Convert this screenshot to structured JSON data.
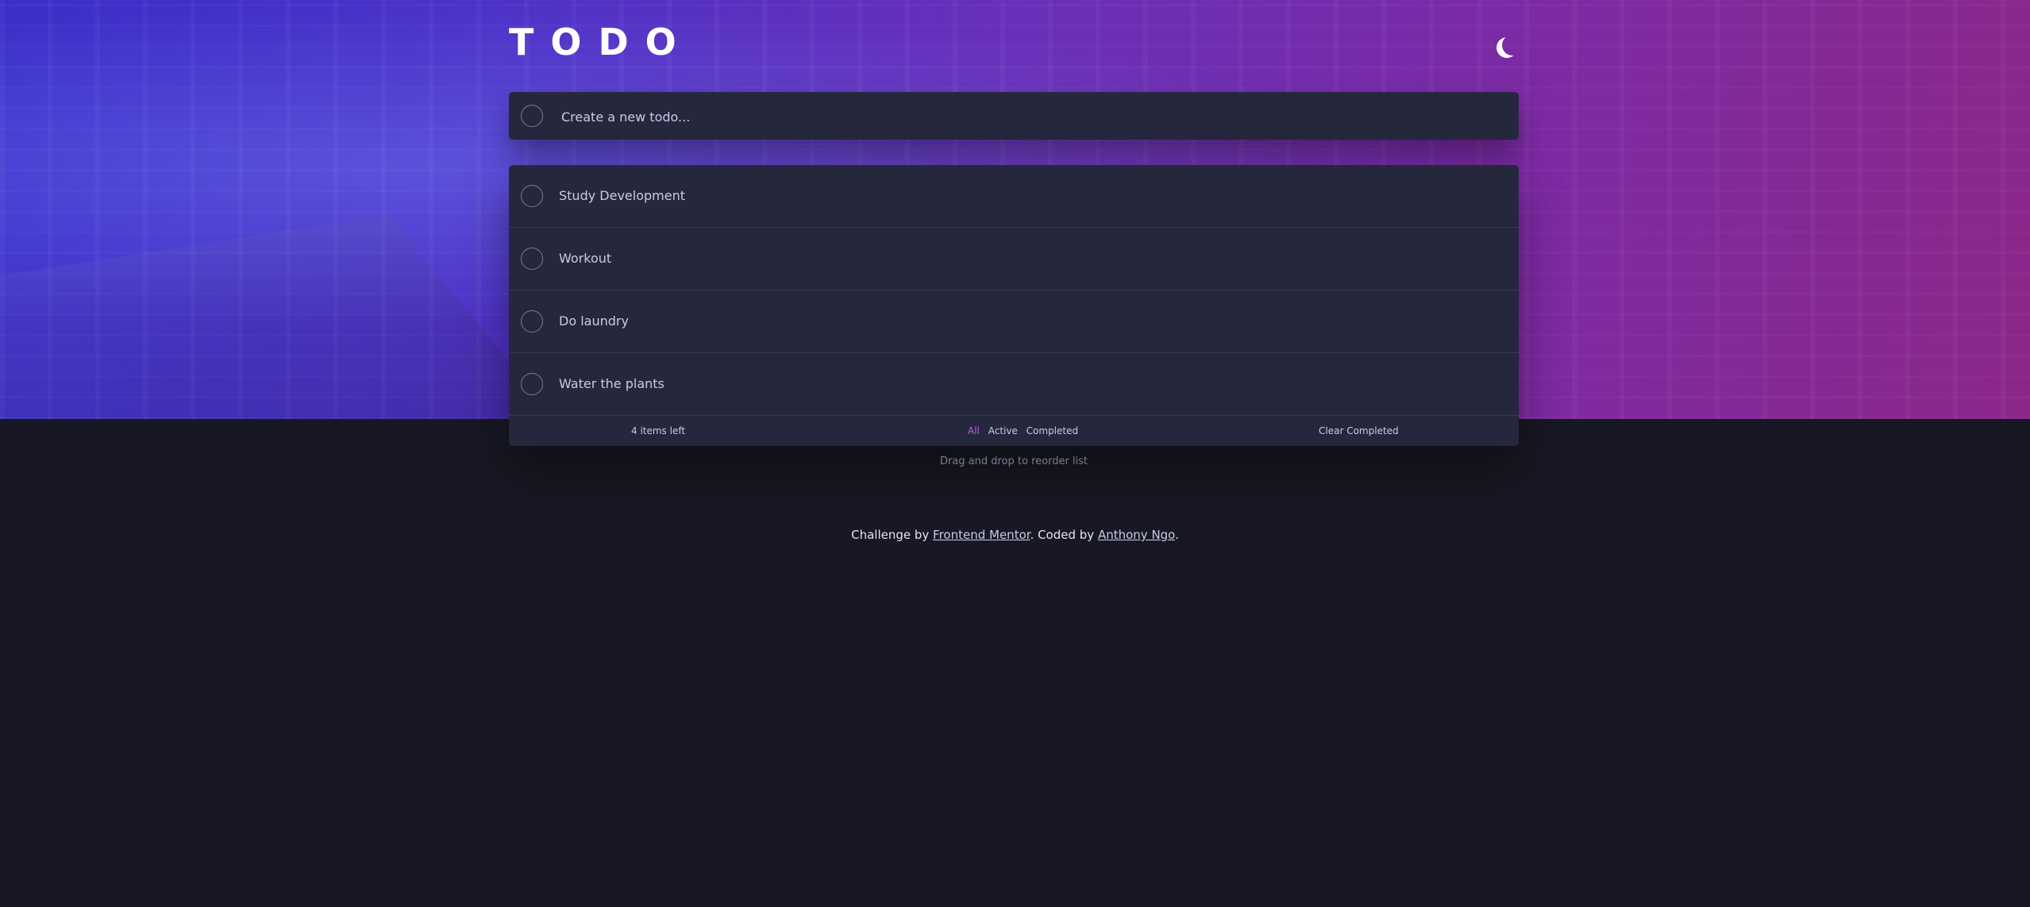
{
  "header": {
    "title": "TODO",
    "theme_icon": "moon-icon"
  },
  "new_todo": {
    "placeholder": "Create a new todo...",
    "value": ""
  },
  "todos": [
    {
      "label": "Study Development",
      "completed": false
    },
    {
      "label": "Workout",
      "completed": false
    },
    {
      "label": "Do laundry",
      "completed": false
    },
    {
      "label": "Water the plants",
      "completed": false
    }
  ],
  "footer": {
    "items_left": "4 items left",
    "filters": {
      "all": "All",
      "active": "Active",
      "completed": "Completed"
    },
    "selected_filter": "All",
    "clear_completed": "Clear Completed"
  },
  "hint": "Drag and drop to reorder list",
  "attribution": {
    "prefix": "Challenge by ",
    "link1": "Frontend Mentor",
    "middle": ". Coded by ",
    "link2": "Anthony Ngo",
    "suffix": "."
  },
  "colors": {
    "accent": "#c058f3",
    "card_bg": "#25273c",
    "page_bg": "#181824",
    "gradient_start": "#3a2fc9",
    "gradient_end": "#8c2789"
  }
}
